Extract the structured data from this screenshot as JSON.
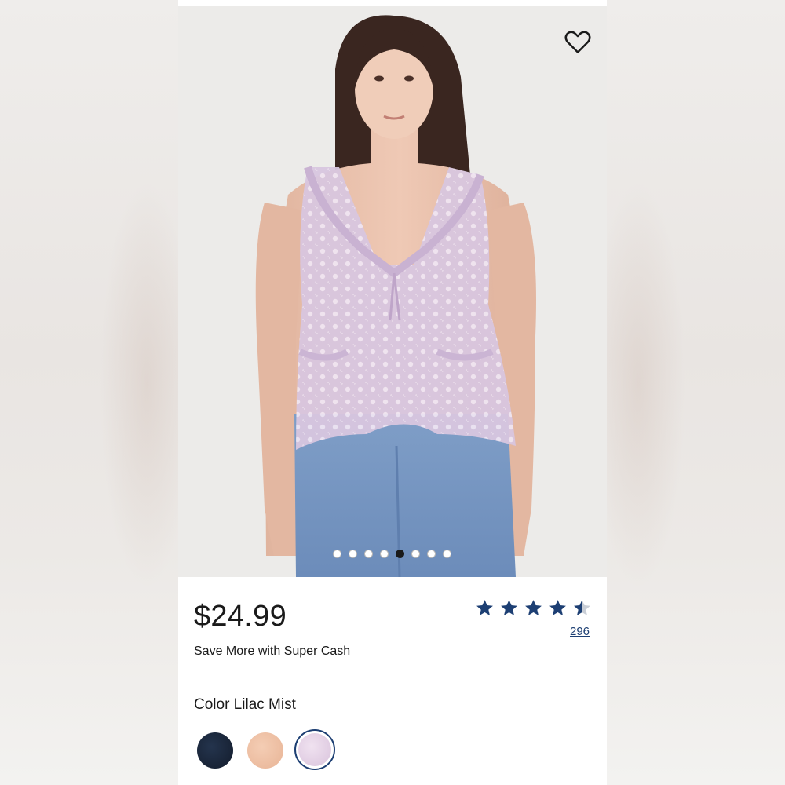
{
  "product": {
    "price": "$24.99",
    "promo": "Save More with Super Cash",
    "rating_value": 4.6,
    "rating_max": 5,
    "review_count": "296",
    "color_label": "Color Lilac Mist",
    "selected_image_index": 5,
    "image_count": 8
  },
  "colors": {
    "accent": "#1d3f73",
    "swatches": [
      "#1b2436",
      "#efc4a8",
      "#e6d3e6"
    ]
  },
  "icons": {
    "favorite": "heart-outline-icon",
    "rating": "star-icon"
  }
}
